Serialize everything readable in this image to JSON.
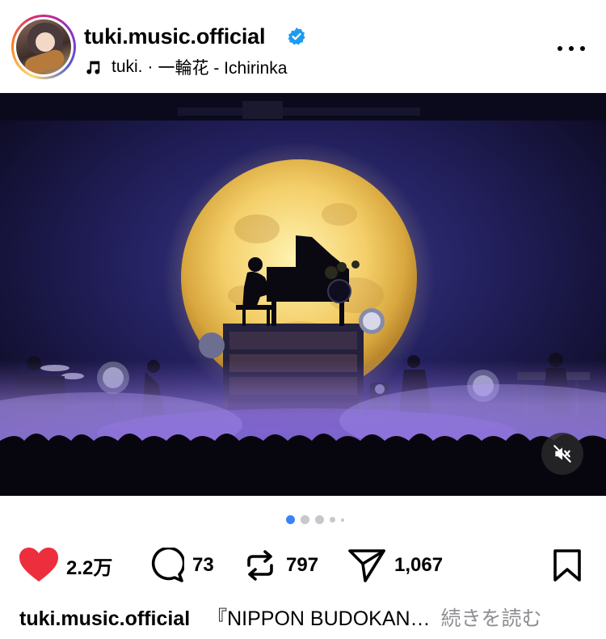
{
  "post": {
    "username": "tuki.music.official",
    "verified": true,
    "music": {
      "artist": "tuki.",
      "separator": "·",
      "track": "一輪花 - Ichirinka"
    },
    "more_icon": "more-horizontal-icon"
  },
  "media": {
    "carousel": {
      "total": 5,
      "current": 1
    },
    "mute_icon": "speaker-muted-icon"
  },
  "actions": {
    "likes": "2.2万",
    "comments": "73",
    "reposts": "797",
    "shares": "1,067"
  },
  "caption": {
    "username": "tuki.music.official",
    "text": "『NIPPON BUDOKAN…",
    "more": "続きを読む"
  },
  "colors": {
    "verified": "#1d9bf0",
    "like": "#ed2e3d",
    "dot_active": "#3b82f6",
    "dot_inactive": "#c7c7cc",
    "muted_text": "#8e8e93"
  }
}
